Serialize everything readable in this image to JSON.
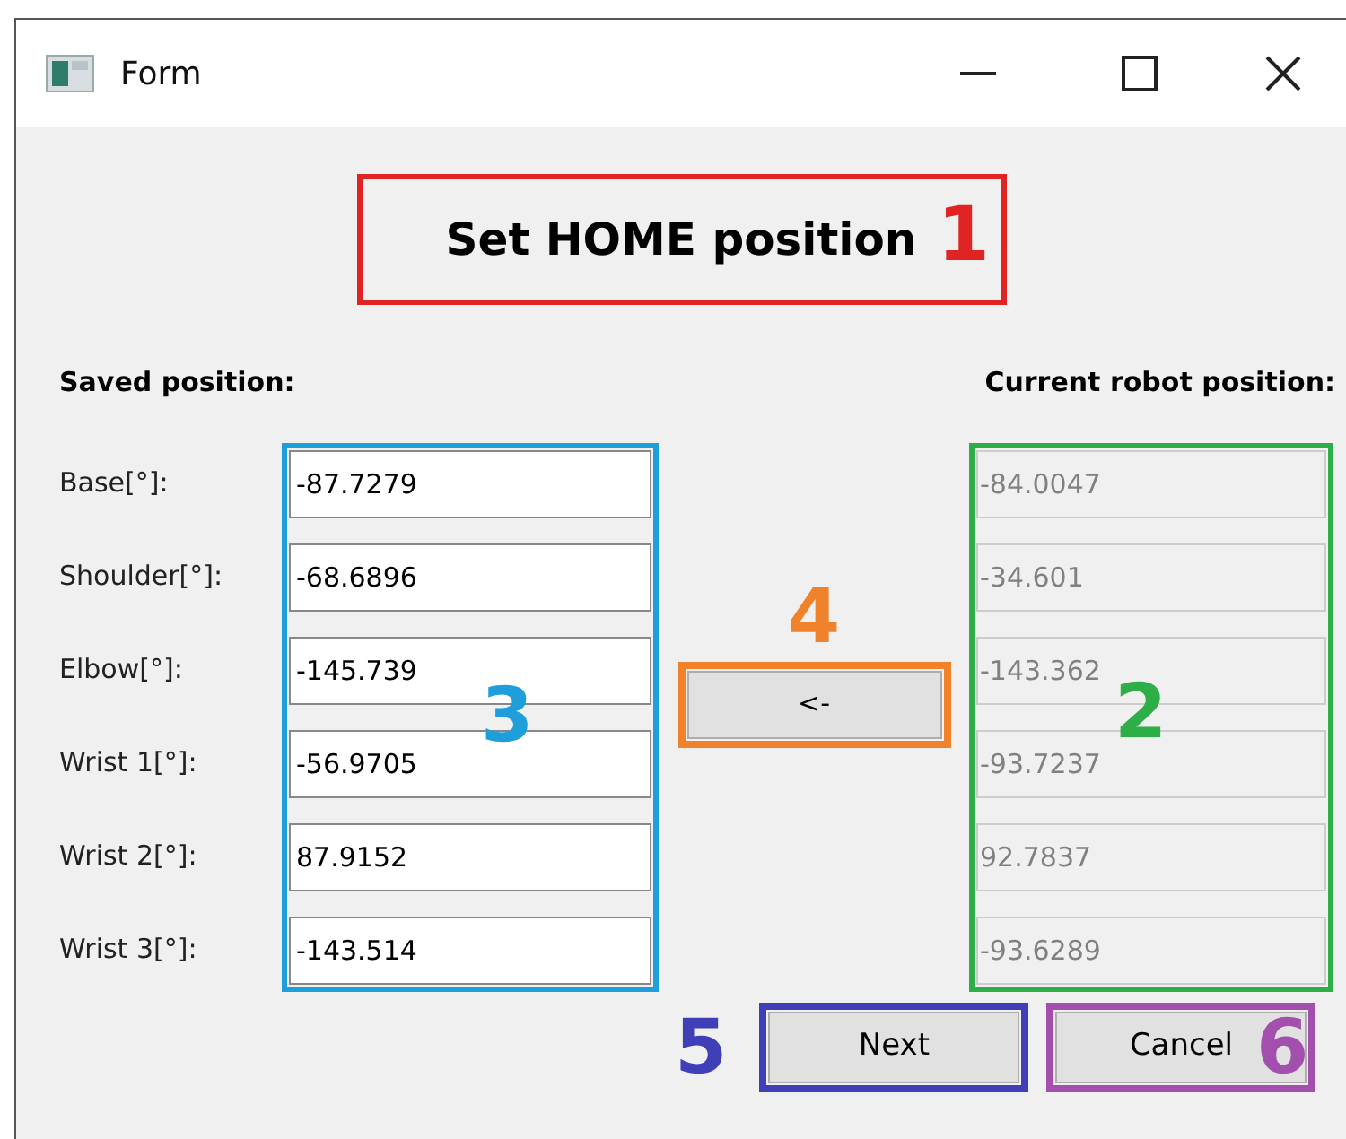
{
  "window": {
    "title": "Form"
  },
  "heading": {
    "text": "Set HOME position",
    "annotation": {
      "number": "1",
      "color": "#e02424"
    }
  },
  "saved_header": "Saved position:",
  "current_header": "Current robot position:",
  "joints": [
    {
      "label": "Base[°]:",
      "saved": "-87.7279",
      "current": "-84.0047"
    },
    {
      "label": "Shoulder[°]:",
      "saved": "-68.6896",
      "current": "-34.601"
    },
    {
      "label": "Elbow[°]:",
      "saved": "-145.739",
      "current": "-143.362"
    },
    {
      "label": "Wrist 1[°]:",
      "saved": "-56.9705",
      "current": "-93.7237"
    },
    {
      "label": "Wrist 2[°]:",
      "saved": "87.9152",
      "current": "92.7837"
    },
    {
      "label": "Wrist 3[°]:",
      "saved": "-143.514",
      "current": "-93.6289"
    }
  ],
  "saved_annotation": {
    "number": "3",
    "color": "#1e9fdc"
  },
  "current_annotation": {
    "number": "2",
    "color": "#2eae47"
  },
  "current_disabled": true,
  "copy_button": {
    "label": "<-",
    "annotation": {
      "number": "4",
      "color": "#f0822c"
    }
  },
  "buttons": [
    {
      "label": "Next",
      "annotation": {
        "number": "5",
        "color": "#3f3fb8"
      }
    },
    {
      "label": "Cancel",
      "annotation": {
        "number": "6",
        "color": "#a24fae"
      }
    }
  ]
}
